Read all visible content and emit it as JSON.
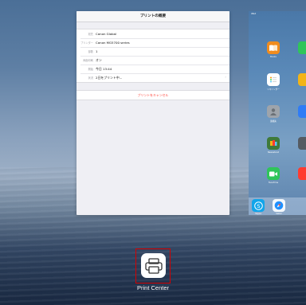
{
  "print_options": {
    "title": "プリントの概要",
    "rows": [
      {
        "label": "宛先",
        "value": "Canon Global"
      },
      {
        "label": "プリンター",
        "value": "Canon MG5700 series"
      },
      {
        "label": "部数",
        "value": "1"
      },
      {
        "label": "両面印刷",
        "value": "オン"
      },
      {
        "label": "開始",
        "value": "今日 13:44"
      },
      {
        "label": "状況",
        "value": "2日をプリント中..."
      }
    ],
    "cancel_label": "プリントをキャンセル"
  },
  "home_screen": {
    "carrier": "iPad",
    "apps": [
      {
        "name": "Books",
        "color": "#f08c1e",
        "icon": "book-icon"
      },
      {
        "name": "",
        "color": "#2fc55a",
        "icon": "green-app-icon"
      },
      {
        "name": "リマインダー",
        "color": "#ffffff",
        "icon": "reminders-icon"
      },
      {
        "name": "",
        "color": "#f3b417",
        "icon": "yellow-app-icon"
      },
      {
        "name": "連絡先",
        "color": "#9ea4ab",
        "icon": "contacts-icon"
      },
      {
        "name": "",
        "color": "#2f7cf6",
        "icon": "blue-app-icon"
      },
      {
        "name": "Newsstand",
        "color": "#3f7a3a",
        "icon": "newsstand-icon"
      },
      {
        "name": "",
        "color": "#555b62",
        "icon": "dark-app-icon"
      },
      {
        "name": "FaceTime",
        "color": "#2fc55a",
        "icon": "facetime-icon"
      },
      {
        "name": "",
        "color": "#ff3b30",
        "icon": "red-app-icon"
      }
    ],
    "dock": [
      {
        "name": "Skype",
        "color": "#12a5ea",
        "icon": "skype-icon"
      },
      {
        "name": "Safari",
        "color": "#1e90ff",
        "icon": "safari-icon"
      }
    ]
  },
  "switcher": {
    "app_label": "Print Center",
    "icon": "printer-icon"
  }
}
